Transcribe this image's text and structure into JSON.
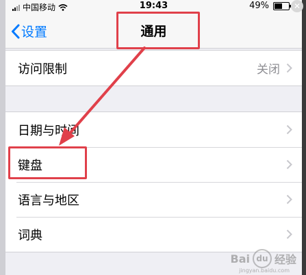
{
  "status_bar": {
    "carrier": "中国移动",
    "time": "19:43",
    "battery": "49%",
    "battery_level": 0.49
  },
  "navbar": {
    "back_label": "设置",
    "title": "通用"
  },
  "group1": {
    "rows": [
      {
        "label": "访问限制",
        "value": "关闭"
      }
    ]
  },
  "group2": {
    "rows": [
      {
        "label": "日期与时间"
      },
      {
        "label": "键盘"
      },
      {
        "label": "语言与地区"
      },
      {
        "label": "词典"
      }
    ]
  },
  "watermark": {
    "logo": "Bai",
    "text": "经验",
    "sub": "jingyan.baidu.com"
  },
  "colors": {
    "accent": "#007aff",
    "annotation": "#e0404a",
    "secondary_text": "#8e8e93"
  },
  "icons": [
    "signal-icon",
    "wifi-icon",
    "battery-icon",
    "back-chevron-icon",
    "chevron-right-icon",
    "close-icon"
  ]
}
